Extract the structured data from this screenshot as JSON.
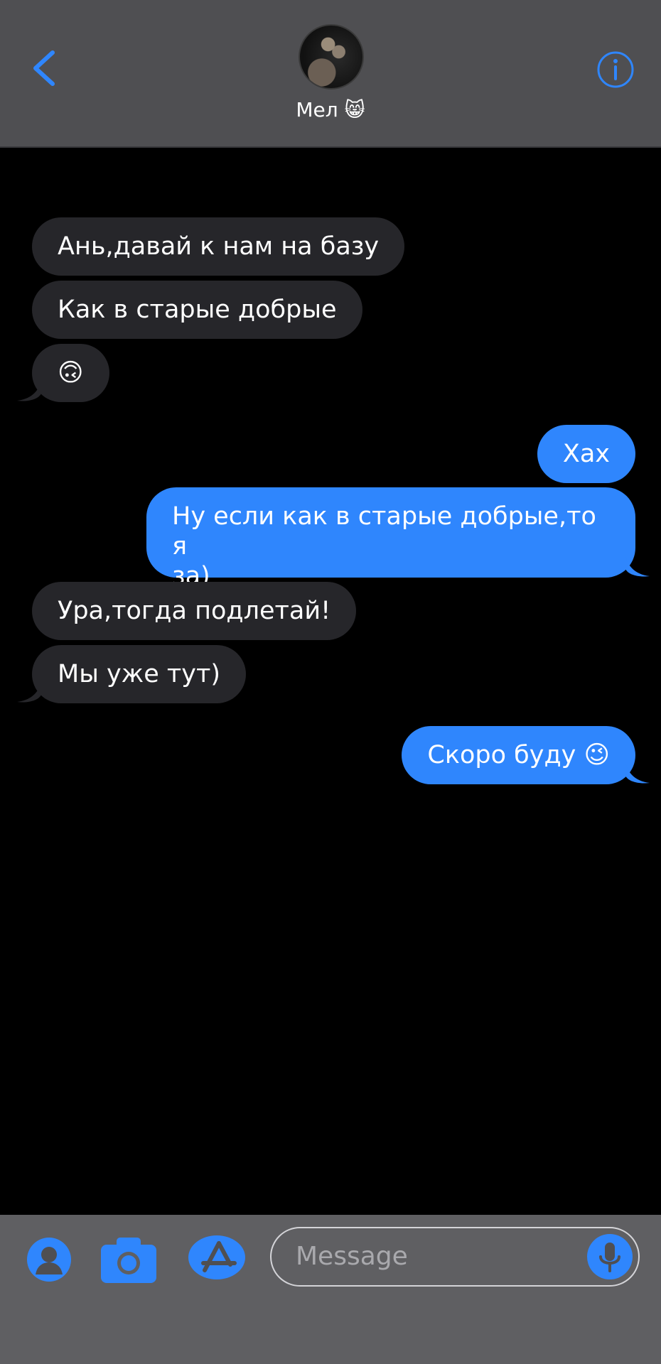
{
  "header": {
    "contact_name": "Мел 😸",
    "back_icon": "chevron-left-icon",
    "info_icon": "info-icon",
    "accent": "#2f86fd"
  },
  "messages": [
    {
      "dir": "incoming",
      "text": "Ань,давай к нам на базу"
    },
    {
      "dir": "incoming",
      "text": "Как в старые добрые"
    },
    {
      "dir": "incoming",
      "text": "🙃"
    },
    {
      "dir": "outgoing",
      "text": "Хах"
    },
    {
      "dir": "outgoing",
      "text": "Ну если как в старые добрые,то я"
    },
    {
      "dir": "outgoing",
      "text": "за)"
    },
    {
      "dir": "incoming",
      "text": "Ура,тогда подлетай!"
    },
    {
      "dir": "incoming",
      "text": "Мы уже тут)"
    },
    {
      "dir": "outgoing",
      "text": "Скоро буду 😉"
    }
  ],
  "composer": {
    "placeholder": "Message",
    "icons": [
      "contact-icon",
      "camera-icon",
      "app-store-icon",
      "microphone-icon"
    ]
  },
  "colors": {
    "incoming_bubble": "#26262a",
    "outgoing_bubble": "#2f86fd",
    "header_bg": "#4f4f52",
    "composer_bg": "#5f5f62"
  }
}
